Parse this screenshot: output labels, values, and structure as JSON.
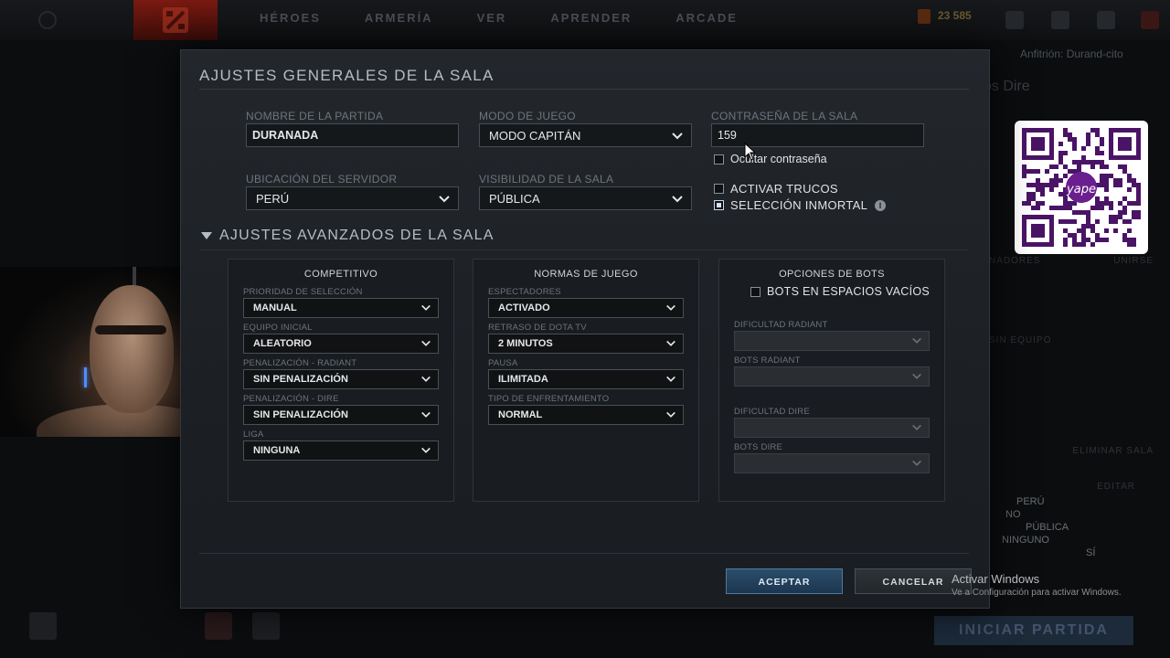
{
  "background": {
    "topnav": [
      "HÉROES",
      "ARMERÍA",
      "VER",
      "APRENDER",
      "ARCADE"
    ],
    "gold_value": "23 585",
    "host_text": "Anfitrión: Durand-cito",
    "dire_text": "os Dire",
    "side_text": [
      "NADORES",
      "UNIRSE",
      "SIN EQUIPO",
      "ELIMINAR SALA",
      "EDITAR"
    ],
    "info_rows": [
      {
        "value": "PERÚ"
      },
      {
        "value": "NO"
      },
      {
        "value": "PÚBLICA"
      },
      {
        "value": "NINGUNO"
      },
      {
        "value": "SÍ"
      }
    ],
    "start_button": "INICIAR PARTIDA"
  },
  "dialog": {
    "title": "AJUSTES GENERALES DE LA SALA",
    "game_name": {
      "label": "NOMBRE DE LA PARTIDA",
      "value": "DURANADA"
    },
    "game_mode": {
      "label": "MODO DE JUEGO",
      "value": "MODO CAPITÁN"
    },
    "password": {
      "label": "CONTRASEÑA DE LA SALA",
      "value": "159"
    },
    "hide_password": {
      "label": "Ocultar contraseña",
      "checked": false
    },
    "server_location": {
      "label": "UBICACIÓN DEL SERVIDOR",
      "value": "PERÚ"
    },
    "visibility": {
      "label": "VISIBILIDAD DE LA SALA",
      "value": "PÚBLICA"
    },
    "enable_cheats": {
      "label": "ACTIVAR TRUCOS",
      "checked": false
    },
    "immortal_pick": {
      "label": "SELECCIÓN INMORTAL",
      "checked": false
    },
    "advanced_title": "AJUSTES AVANZADOS DE LA SALA",
    "competitive": {
      "title": "COMPETITIVO",
      "fields": [
        {
          "label": "PRIORIDAD DE SELECCIÓN",
          "value": "MANUAL"
        },
        {
          "label": "EQUIPO INICIAL",
          "value": "ALEATORIO"
        },
        {
          "label": "PENALIZACIÓN - RADIANT",
          "value": "SIN PENALIZACIÓN"
        },
        {
          "label": "PENALIZACIÓN - DIRE",
          "value": "SIN PENALIZACIÓN"
        },
        {
          "label": "LIGA",
          "value": "NINGUNA"
        }
      ]
    },
    "game_rules": {
      "title": "NORMAS DE JUEGO",
      "fields": [
        {
          "label": "ESPECTADORES",
          "value": "ACTIVADO"
        },
        {
          "label": "RETRASO DE DOTA TV",
          "value": "2 MINUTOS"
        },
        {
          "label": "PAUSA",
          "value": "ILIMITADA"
        },
        {
          "label": "TIPO DE ENFRENTAMIENTO",
          "value": "NORMAL"
        }
      ]
    },
    "bot_options": {
      "title": "OPCIONES DE BOTS",
      "fill_bots": {
        "label": "BOTS EN ESPACIOS VACÍOS",
        "checked": false
      },
      "fields": [
        {
          "label": "DIFICULTAD RADIANT",
          "value": ""
        },
        {
          "label": "BOTS RADIANT",
          "value": ""
        },
        {
          "label": "DIFICULTAD DIRE",
          "value": ""
        },
        {
          "label": "BOTS DIRE",
          "value": ""
        }
      ]
    },
    "accept_label": "ACEPTAR",
    "cancel_label": "CANCELAR"
  },
  "watermark": {
    "title": "Activar Windows",
    "subtitle": "Ve a Configuración para activar Windows."
  },
  "qr": {
    "brand": "yape"
  },
  "colors": {
    "accent_blue": "#2b4d69",
    "dialog_bg": "#1f2327"
  }
}
